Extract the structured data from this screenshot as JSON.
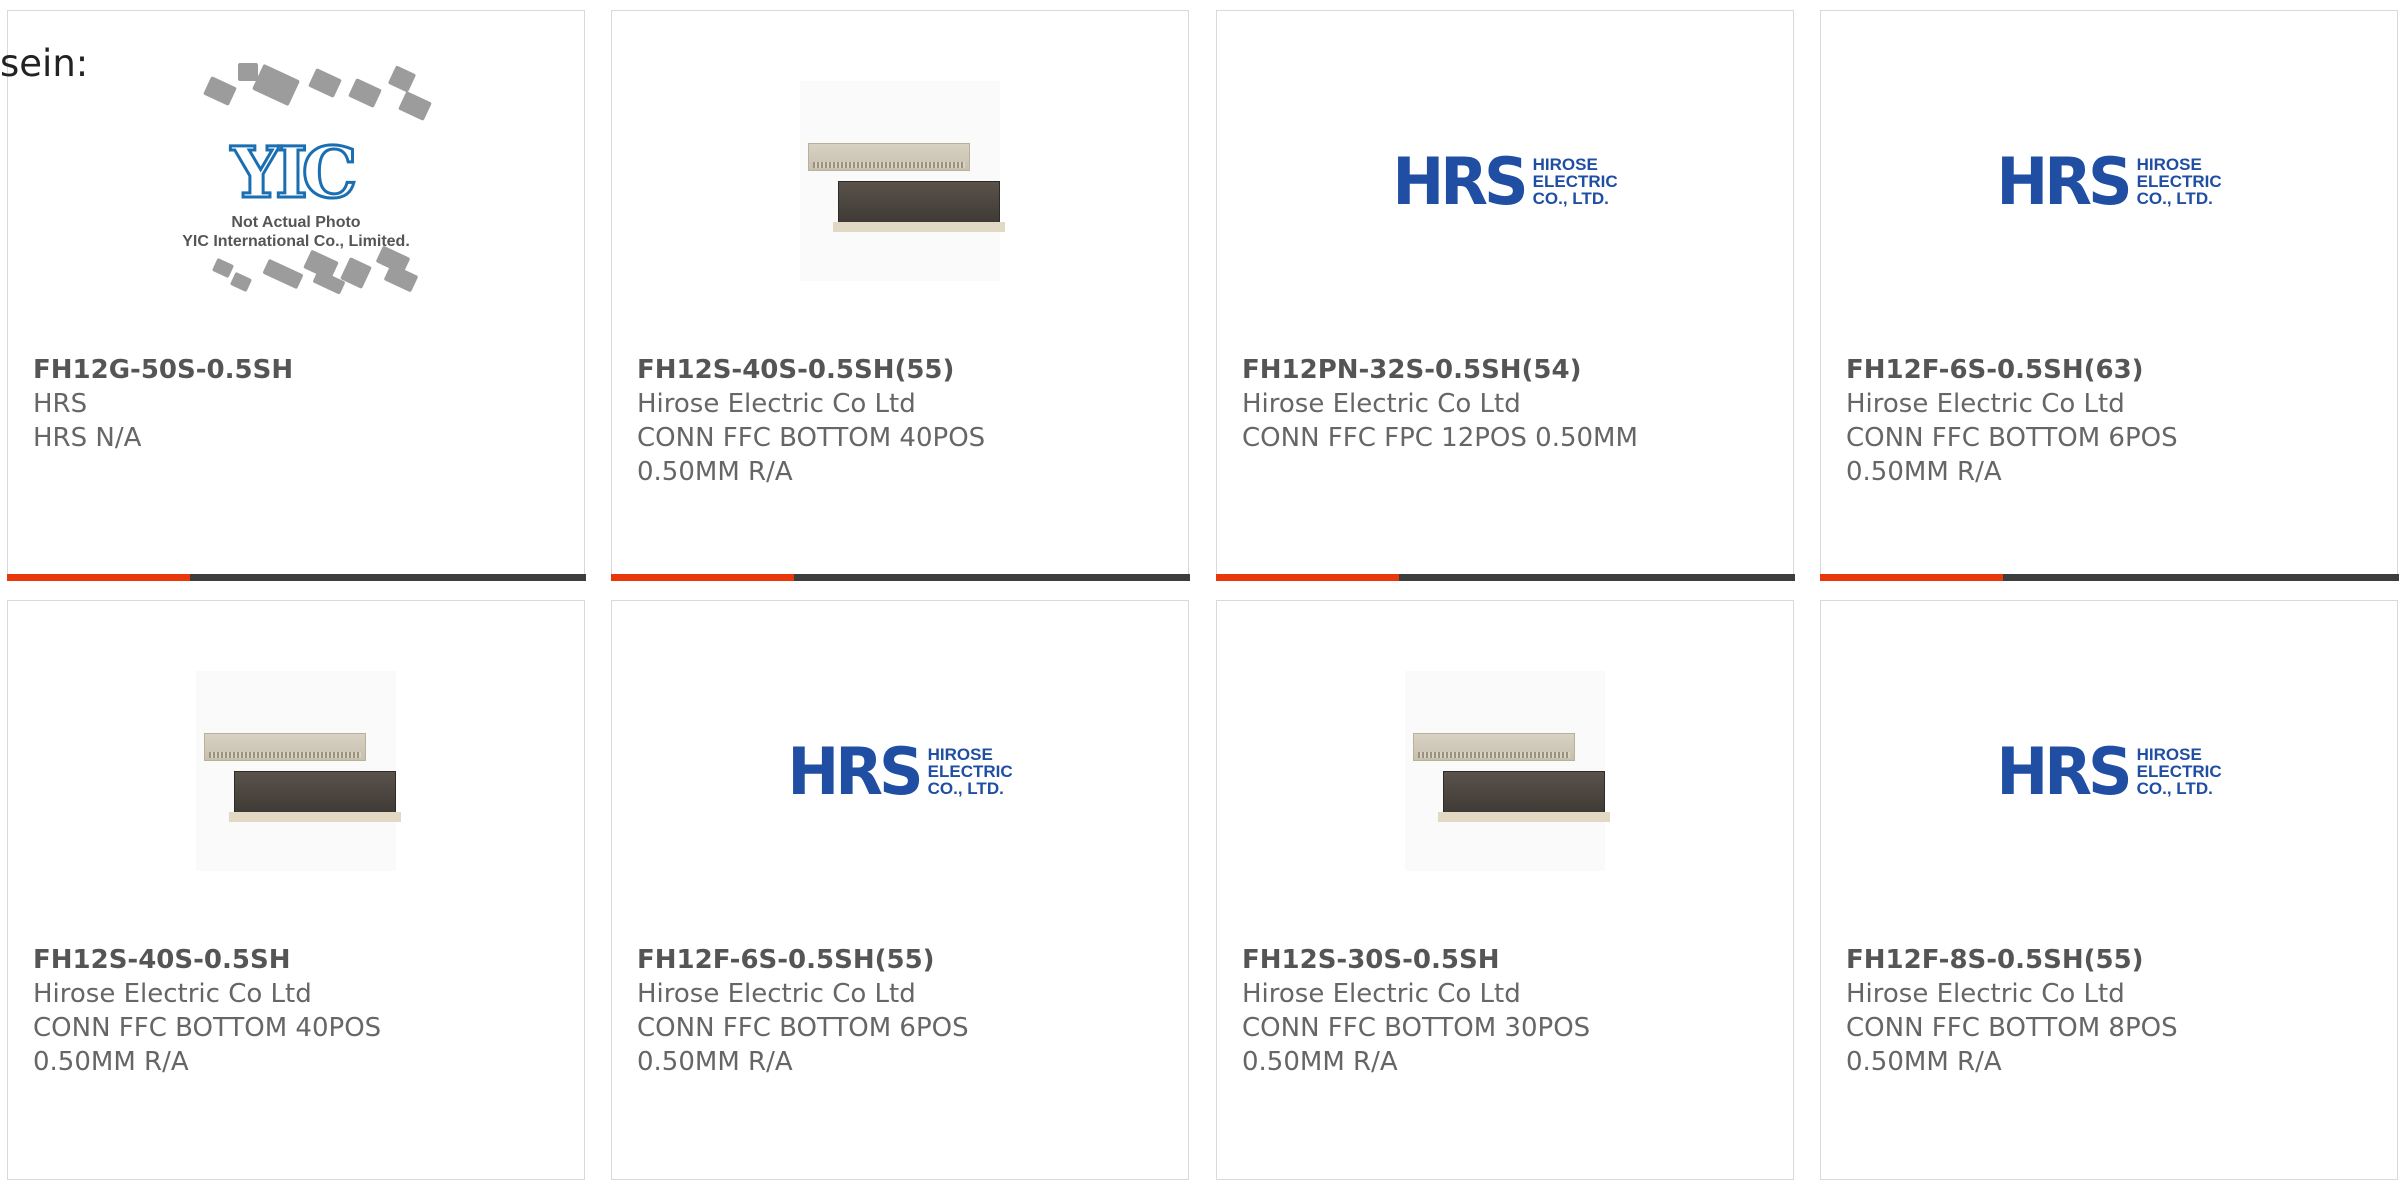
{
  "intro_text": "sein:",
  "colors": {
    "accent": "#e8370a",
    "bar": "#3d3d3d",
    "logo_blue": "#1f4ea3"
  },
  "products": [
    {
      "part": "FH12G-50S-0.5SH",
      "manufacturer": "HRS",
      "desc1": "HRS N/A",
      "desc2": "",
      "image": "yic-placeholder",
      "image_caption": [
        "Not Actual Photo",
        "YIC International Co., Limited."
      ],
      "image_mark": "YIC"
    },
    {
      "part": "FH12S-40S-0.5SH(55)",
      "manufacturer": "Hirose Electric Co Ltd",
      "desc1": "CONN FFC BOTTOM 40POS",
      "desc2": "0.50MM R/A",
      "image": "connector-photo"
    },
    {
      "part": "FH12PN-32S-0.5SH(54)",
      "manufacturer": "Hirose Electric Co Ltd",
      "desc1": "CONN FFC FPC 12POS 0.50MM",
      "desc2": "",
      "image": "hrs-logo"
    },
    {
      "part": "FH12F-6S-0.5SH(63)",
      "manufacturer": "Hirose Electric Co Ltd",
      "desc1": "CONN FFC BOTTOM 6POS",
      "desc2": "0.50MM R/A",
      "image": "hrs-logo"
    },
    {
      "part": "FH12S-40S-0.5SH",
      "manufacturer": "Hirose Electric Co Ltd",
      "desc1": "CONN FFC BOTTOM 40POS",
      "desc2": "0.50MM R/A",
      "image": "connector-photo"
    },
    {
      "part": "FH12F-6S-0.5SH(55)",
      "manufacturer": "Hirose Electric Co Ltd",
      "desc1": "CONN FFC BOTTOM 6POS",
      "desc2": "0.50MM R/A",
      "image": "hrs-logo"
    },
    {
      "part": "FH12S-30S-0.5SH",
      "manufacturer": "Hirose Electric Co Ltd",
      "desc1": "CONN FFC BOTTOM 30POS",
      "desc2": "0.50MM R/A",
      "image": "connector-photo"
    },
    {
      "part": "FH12F-8S-0.5SH(55)",
      "manufacturer": "Hirose Electric Co Ltd",
      "desc1": "CONN FFC BOTTOM 8POS",
      "desc2": "0.50MM R/A",
      "image": "hrs-logo"
    }
  ],
  "hrs_logo": {
    "big": "HRS",
    "lines": [
      "HIROSE",
      "ELECTRIC",
      "CO., LTD."
    ]
  }
}
